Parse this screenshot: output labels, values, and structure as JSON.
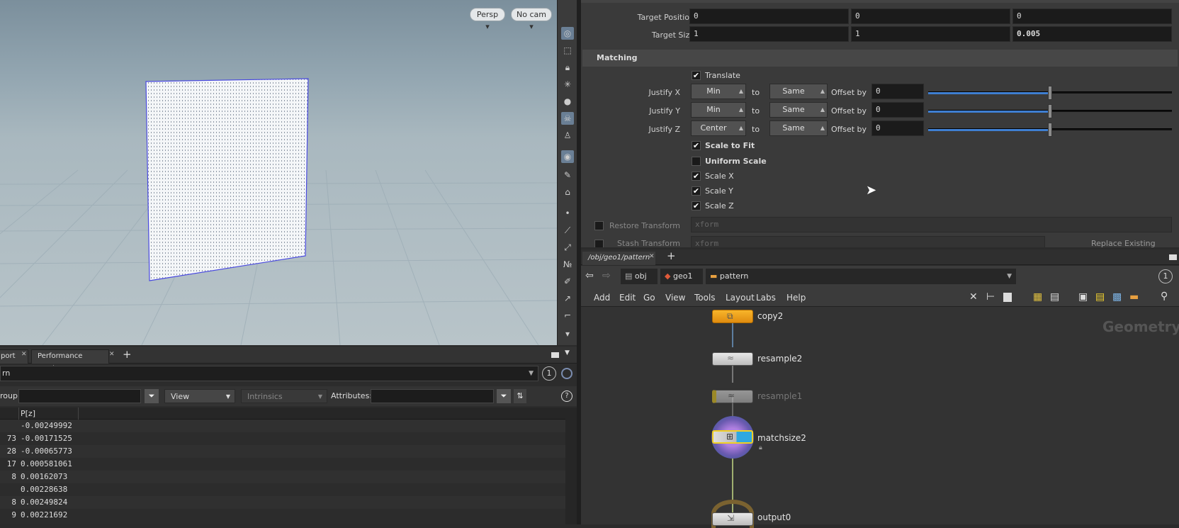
{
  "viewport": {
    "persp_label": "Persp",
    "cam_label": "No cam"
  },
  "spreadsheet": {
    "tabs": [
      "port",
      "Performance Monitor"
    ],
    "path_value": "rn",
    "badge": "1",
    "group_label": "roup:",
    "view_label": "View",
    "intrinsics_label": "Intrinsics",
    "attributes_label": "Attributes:",
    "help": "?",
    "column_header": "P[z]",
    "rows": [
      {
        "idx": "",
        "pz": "-0.00249992"
      },
      {
        "idx": "73",
        "pz": "-0.00171525"
      },
      {
        "idx": "28",
        "pz": "-0.00065773"
      },
      {
        "idx": "17",
        "pz": "0.000581061"
      },
      {
        "idx": "8",
        "pz": "0.00162073"
      },
      {
        "idx": "",
        "pz": "0.00228638"
      },
      {
        "idx": "8",
        "pz": "0.00249824"
      },
      {
        "idx": "9",
        "pz": "0.00221692"
      }
    ]
  },
  "params": {
    "target_position_label": "Target Position",
    "target_position": [
      "0",
      "0",
      "0"
    ],
    "target_size_label": "Target Size",
    "target_size": [
      "1",
      "1",
      "0.005"
    ],
    "matching_label": "Matching",
    "translate_label": "Translate",
    "justify": [
      {
        "label": "Justify X",
        "mode": "Min",
        "to_label": "to",
        "target": "Same",
        "offset_label": "Offset by",
        "offset": "0",
        "slider": 0.52
      },
      {
        "label": "Justify Y",
        "mode": "Min",
        "to_label": "to",
        "target": "Same",
        "offset_label": "Offset by",
        "offset": "0",
        "slider": 0.52
      },
      {
        "label": "Justify Z",
        "mode": "Center",
        "to_label": "to",
        "target": "Same",
        "offset_label": "Offset by",
        "offset": "0",
        "slider": 0.52
      }
    ],
    "scale_to_fit_label": "Scale to Fit",
    "uniform_scale_label": "Uniform Scale",
    "scale_x_label": "Scale X",
    "scale_y_label": "Scale Y",
    "scale_z_label": "Scale Z",
    "restore_transform_label": "Restore Transform",
    "restore_transform_value": "xform",
    "stash_transform_label": "Stash Transform",
    "stash_transform_value": "xform",
    "replace_existing_label": "Replace Existing"
  },
  "network": {
    "tab_path": "/obj/geo1/pattern",
    "crumbs": [
      "obj",
      "geo1",
      "pattern"
    ],
    "badge": "1",
    "menu": [
      "Add",
      "Edit",
      "Go",
      "View",
      "Tools",
      "Layout",
      "Labs",
      "Help"
    ],
    "context_label": "Geometry",
    "nodes": [
      "copy2",
      "resample2",
      "resample1",
      "matchsize2",
      "output0"
    ]
  },
  "colors": {
    "accent_blue": "#3f7fd2",
    "node_orange": "#f0a020",
    "node_yellow": "#f0d020",
    "node_blue": "#2ea8e0"
  }
}
